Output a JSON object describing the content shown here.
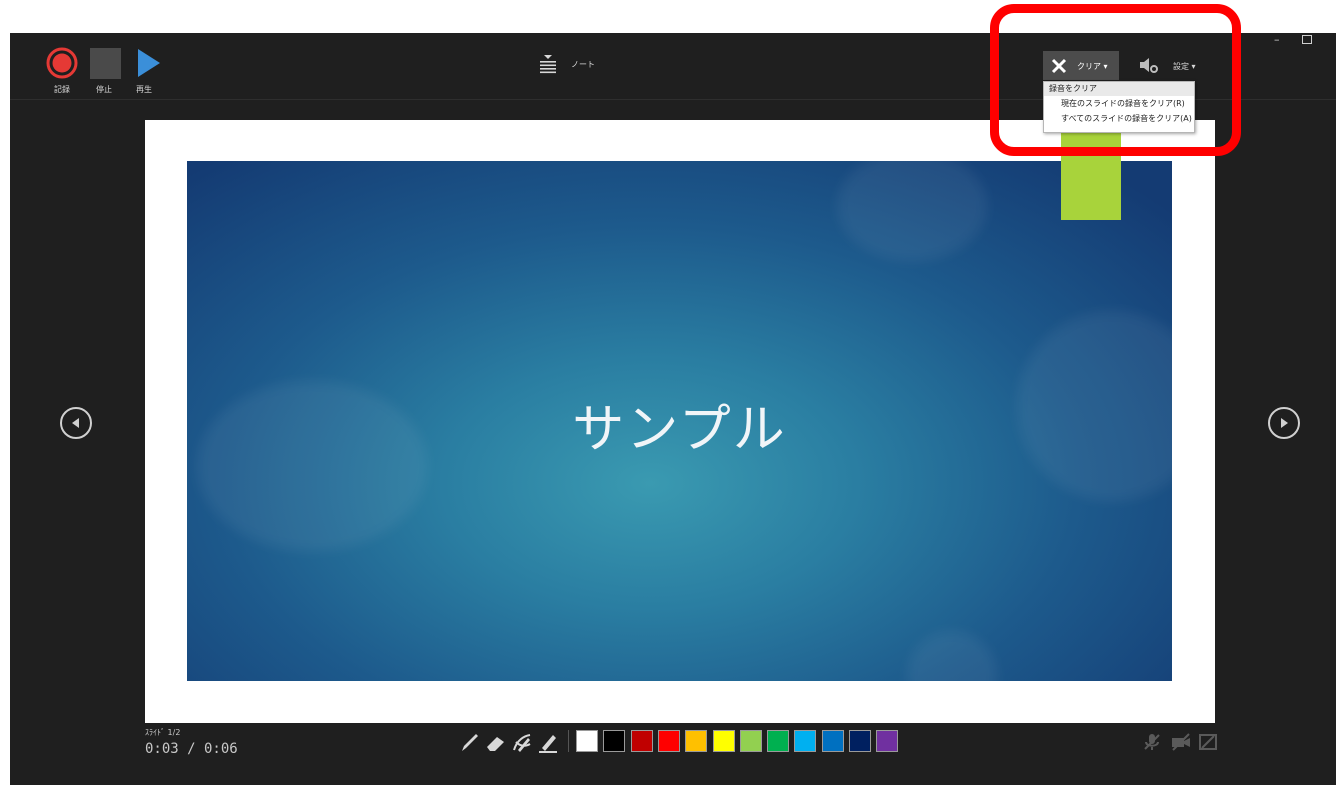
{
  "toolbar": {
    "record_label": "記録",
    "stop_label": "停止",
    "play_label": "再生",
    "notes_label": "ノート",
    "clear_label": "クリア ▾",
    "settings_label": "設定 ▾"
  },
  "window": {
    "minimize": "–",
    "restore": "🗗"
  },
  "dropdown": {
    "header": "録音をクリア",
    "items": [
      "現在のスライドの録音をクリア(R)",
      "すべてのスライドの録音をクリア(A)"
    ]
  },
  "slide": {
    "title": "サンプル"
  },
  "status": {
    "slide_counter": "ｽﾗｲﾄﾞ 1/2",
    "time": "0:03 / 0:06"
  },
  "colors": {
    "record": "#e53935",
    "play": "#3b8fd9",
    "highlight": "#ff0000",
    "green_shape": "#a8d33b",
    "swatches": [
      "#ffffff",
      "#000000",
      "#c00000",
      "#ff0000",
      "#ffc000",
      "#ffff00",
      "#92d050",
      "#00b050",
      "#00b0f0",
      "#0070c0",
      "#002060",
      "#7030a0"
    ]
  },
  "icons": [
    "record-icon",
    "stop-icon",
    "play-icon",
    "notes-icon",
    "close-x-icon",
    "speaker-settings-icon",
    "pen-icon",
    "eraser-icon",
    "laser-pen-icon",
    "highlighter-icon",
    "mic-icon",
    "camera-icon",
    "preview-icon"
  ]
}
